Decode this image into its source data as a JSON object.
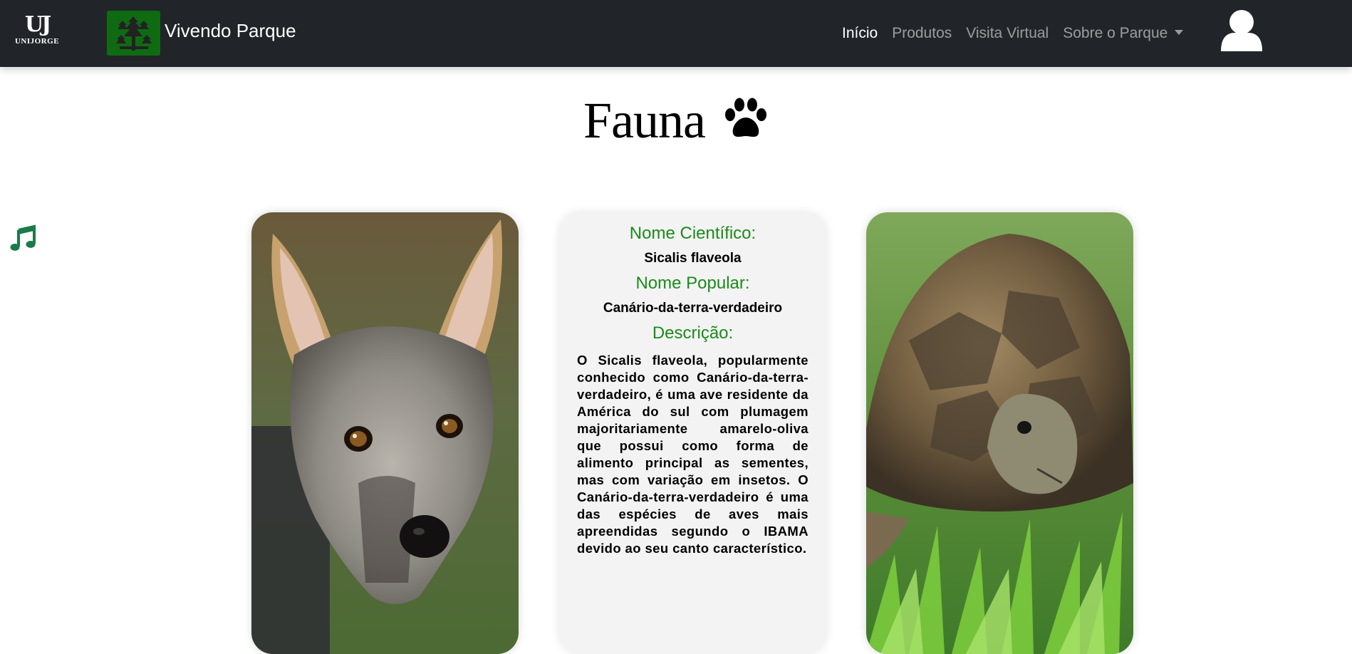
{
  "navbar": {
    "uj_logo_mark": "UJ",
    "uj_logo_word": "UNIJORGE",
    "brand": "Vivendo Parque",
    "links": [
      {
        "label": "Início",
        "active": true
      },
      {
        "label": "Produtos",
        "active": false
      },
      {
        "label": "Visita Virtual",
        "active": false
      },
      {
        "label": "Sobre o Parque",
        "active": false,
        "dropdown": true
      }
    ],
    "user_icon": "user-icon"
  },
  "page": {
    "title": "Fauna",
    "title_icon": "paw-icon",
    "music_icon": "music-note-icon"
  },
  "cards": {
    "left_image": "fox-photo",
    "right_image": "tortoise-photo",
    "info": {
      "scientific_label": "Nome Científico:",
      "scientific_value": "Sicalis flaveola",
      "popular_label": "Nome Popular:",
      "popular_value": "Canário-da-terra-verdadeiro",
      "description_label": "Descrição:",
      "description": "O Sicalis flaveola, popularmente conhecido como Canário-da-terra-verdadeiro, é uma ave residente da América do sul com plumagem majoritariamente amarelo-oliva que possui como forma de alimento principal as sementes, mas com variação em insetos. O Canário-da-terra-verdadeiro é uma das espécies de aves mais apreendidas segundo o IBAMA devido ao seu canto característico."
    }
  },
  "colors": {
    "navbar_bg": "#212529",
    "accent_green": "#1b8a1b",
    "music_icon": "#1a7a4a",
    "info_card_bg": "#f3f3f3"
  }
}
